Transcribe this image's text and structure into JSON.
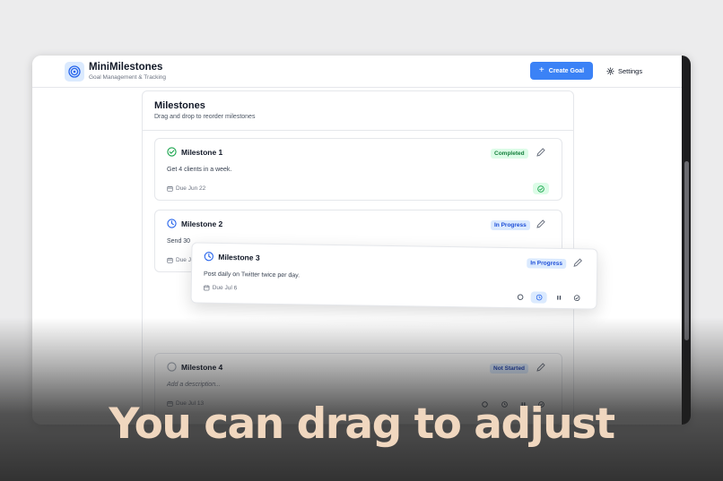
{
  "app": {
    "title": "MiniMilestones",
    "subtitle": "Goal Management & Tracking",
    "create_label": "Create Goal",
    "settings_label": "Settings"
  },
  "panel": {
    "title": "Milestones",
    "subtitle": "Drag and drop to reorder milestones"
  },
  "milestones": [
    {
      "title": "Milestone 1",
      "status": "Completed",
      "description": "Get 4 clients in a week.",
      "due": "Due Jun 22"
    },
    {
      "title": "Milestone 2",
      "status": "In Progress",
      "description": "Send 30",
      "due": "Due Ju"
    },
    {
      "title": "Milestone 3",
      "status": "In Progress",
      "description": "Post daily on Twitter twice per day.",
      "due": "Due Jul 6"
    },
    {
      "title": "Milestone 4",
      "status": "Not Started",
      "description_placeholder": "Add a description...",
      "due": "Due Jul 13"
    }
  ],
  "caption": "You can drag to adjust",
  "colors": {
    "accent": "#3b82f6",
    "completed": "#16a34a",
    "in_progress": "#2563eb",
    "caption": "#f0d7bf"
  }
}
